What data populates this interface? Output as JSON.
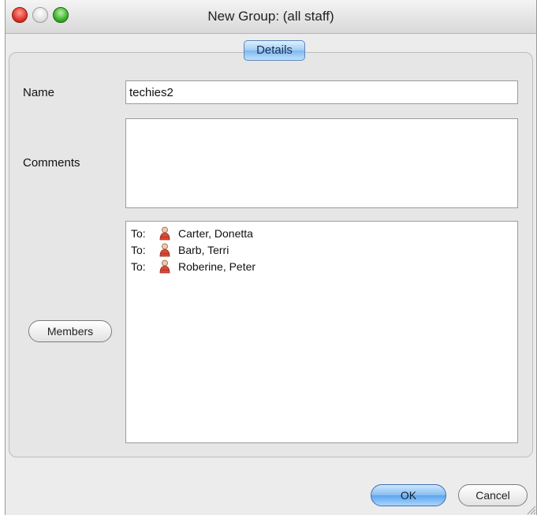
{
  "window": {
    "title": "New Group: (all staff)"
  },
  "tabs": {
    "active": "Details"
  },
  "form": {
    "name_label": "Name",
    "name_value": "techies2",
    "comments_label": "Comments",
    "comments_value": ""
  },
  "members": {
    "button_label": "Members",
    "items": [
      {
        "prefix": "To:",
        "name": "Carter, Donetta",
        "icon": "person-icon"
      },
      {
        "prefix": "To:",
        "name": "Barb, Terri",
        "icon": "person-icon"
      },
      {
        "prefix": "To:",
        "name": "Roberine, Peter",
        "icon": "person-icon"
      }
    ]
  },
  "buttons": {
    "ok": "OK",
    "cancel": "Cancel"
  }
}
